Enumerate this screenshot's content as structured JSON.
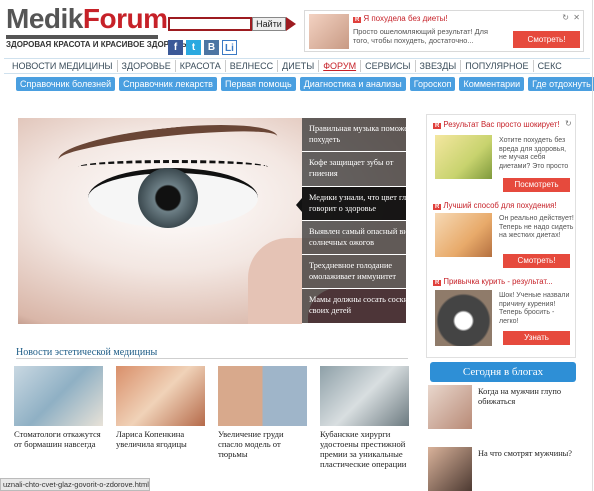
{
  "header": {
    "logo_part1": "Medik",
    "logo_part2": "Forum",
    "tagline": "ЗДОРОВАЯ КРАСОТА И КРАСИВОЕ ЗДОРОВЬЕ",
    "search_button": "Найти",
    "social": [
      "f",
      "t",
      "B",
      "Li"
    ]
  },
  "top_ad": {
    "badge": "R",
    "title": "Я похудела без диеты!",
    "text": "Просто ошеломляющий результат! Для того, чтобы похудеть, достаточно...",
    "button": "Смотреть!",
    "refresh_icon": "↻",
    "close_icon": "✕"
  },
  "nav": {
    "items": [
      "НОВОСТИ МЕДИЦИНЫ",
      "ЗДОРОВЬЕ",
      "КРАСОТА",
      "ВЕЛНЕСС",
      "ДИЕТЫ",
      "ФОРУМ",
      "СЕРВИСЫ",
      "ЗВЕЗДЫ",
      "ПОПУЛЯРНОЕ",
      "СЕКС"
    ],
    "active": "ФОРУМ"
  },
  "subnav": [
    "Справочник болезней",
    "Справочник лекарств",
    "Первая помощь",
    "Диагностика и анализы",
    "Гороскоп",
    "Комментарии",
    "Где отдохнуть"
  ],
  "slider": {
    "items": [
      "Правильная музыка поможет похудеть",
      "Кофе защищает зубы от гниения",
      "Медики узнали, что цвет глаз говорит о здоровье",
      "Выявлен самый опасный вид солнечных ожогов",
      "Трехдневное голодание омолаживает иммунитет",
      "Мамы должны сосать соски своих детей"
    ],
    "selected_index": 2
  },
  "news": {
    "title": "Новости эстетической медицины",
    "items": [
      "Стоматологи откажутся от бормашин навсегда",
      "Лариса Копенкина увеличила ягодицы",
      "Увеличение груди спасло модель от тюрьмы",
      "Кубанские хирурги удостоены престижной премии за уникальные пластические операции"
    ]
  },
  "sidebar_ads": [
    {
      "badge": "R",
      "title": "Результат Вас просто шокирует!",
      "text": "Хотите похудеть без вреда для здоровья, не мучая себя диетами? Это просто",
      "button": "Посмотреть"
    },
    {
      "badge": "R",
      "title": "Лучший способ для похудения!",
      "text": "Он реально действует! Теперь не надо сидеть на жестких диетах!",
      "button": "Смотреть!"
    },
    {
      "badge": "R",
      "title": "Привычка курить - результат...",
      "text": "Шок! Ученые назвали причину курения! Теперь бросить - легко!",
      "button": "Узнать"
    }
  ],
  "blogs": {
    "title": "Сегодня в блогах",
    "items": [
      "Когда на мужчин глупо обижаться",
      "На что смотрят мужчины?"
    ]
  },
  "status_url": "uznali-chto-cvet-glaz-govorit-o-zdorove.html"
}
